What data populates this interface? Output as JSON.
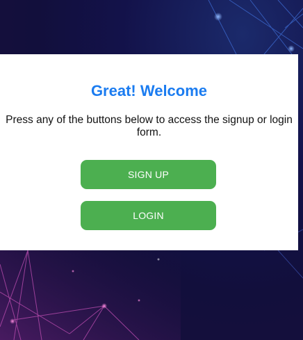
{
  "welcome": {
    "title": "Great! Welcome",
    "description": "Press any of the buttons below to access the signup or login form.",
    "signup_label": "SIGN UP",
    "login_label": "LOGIN"
  },
  "colors": {
    "title": "#1b7cf0",
    "button": "#4caf50",
    "background": "#13124a"
  }
}
